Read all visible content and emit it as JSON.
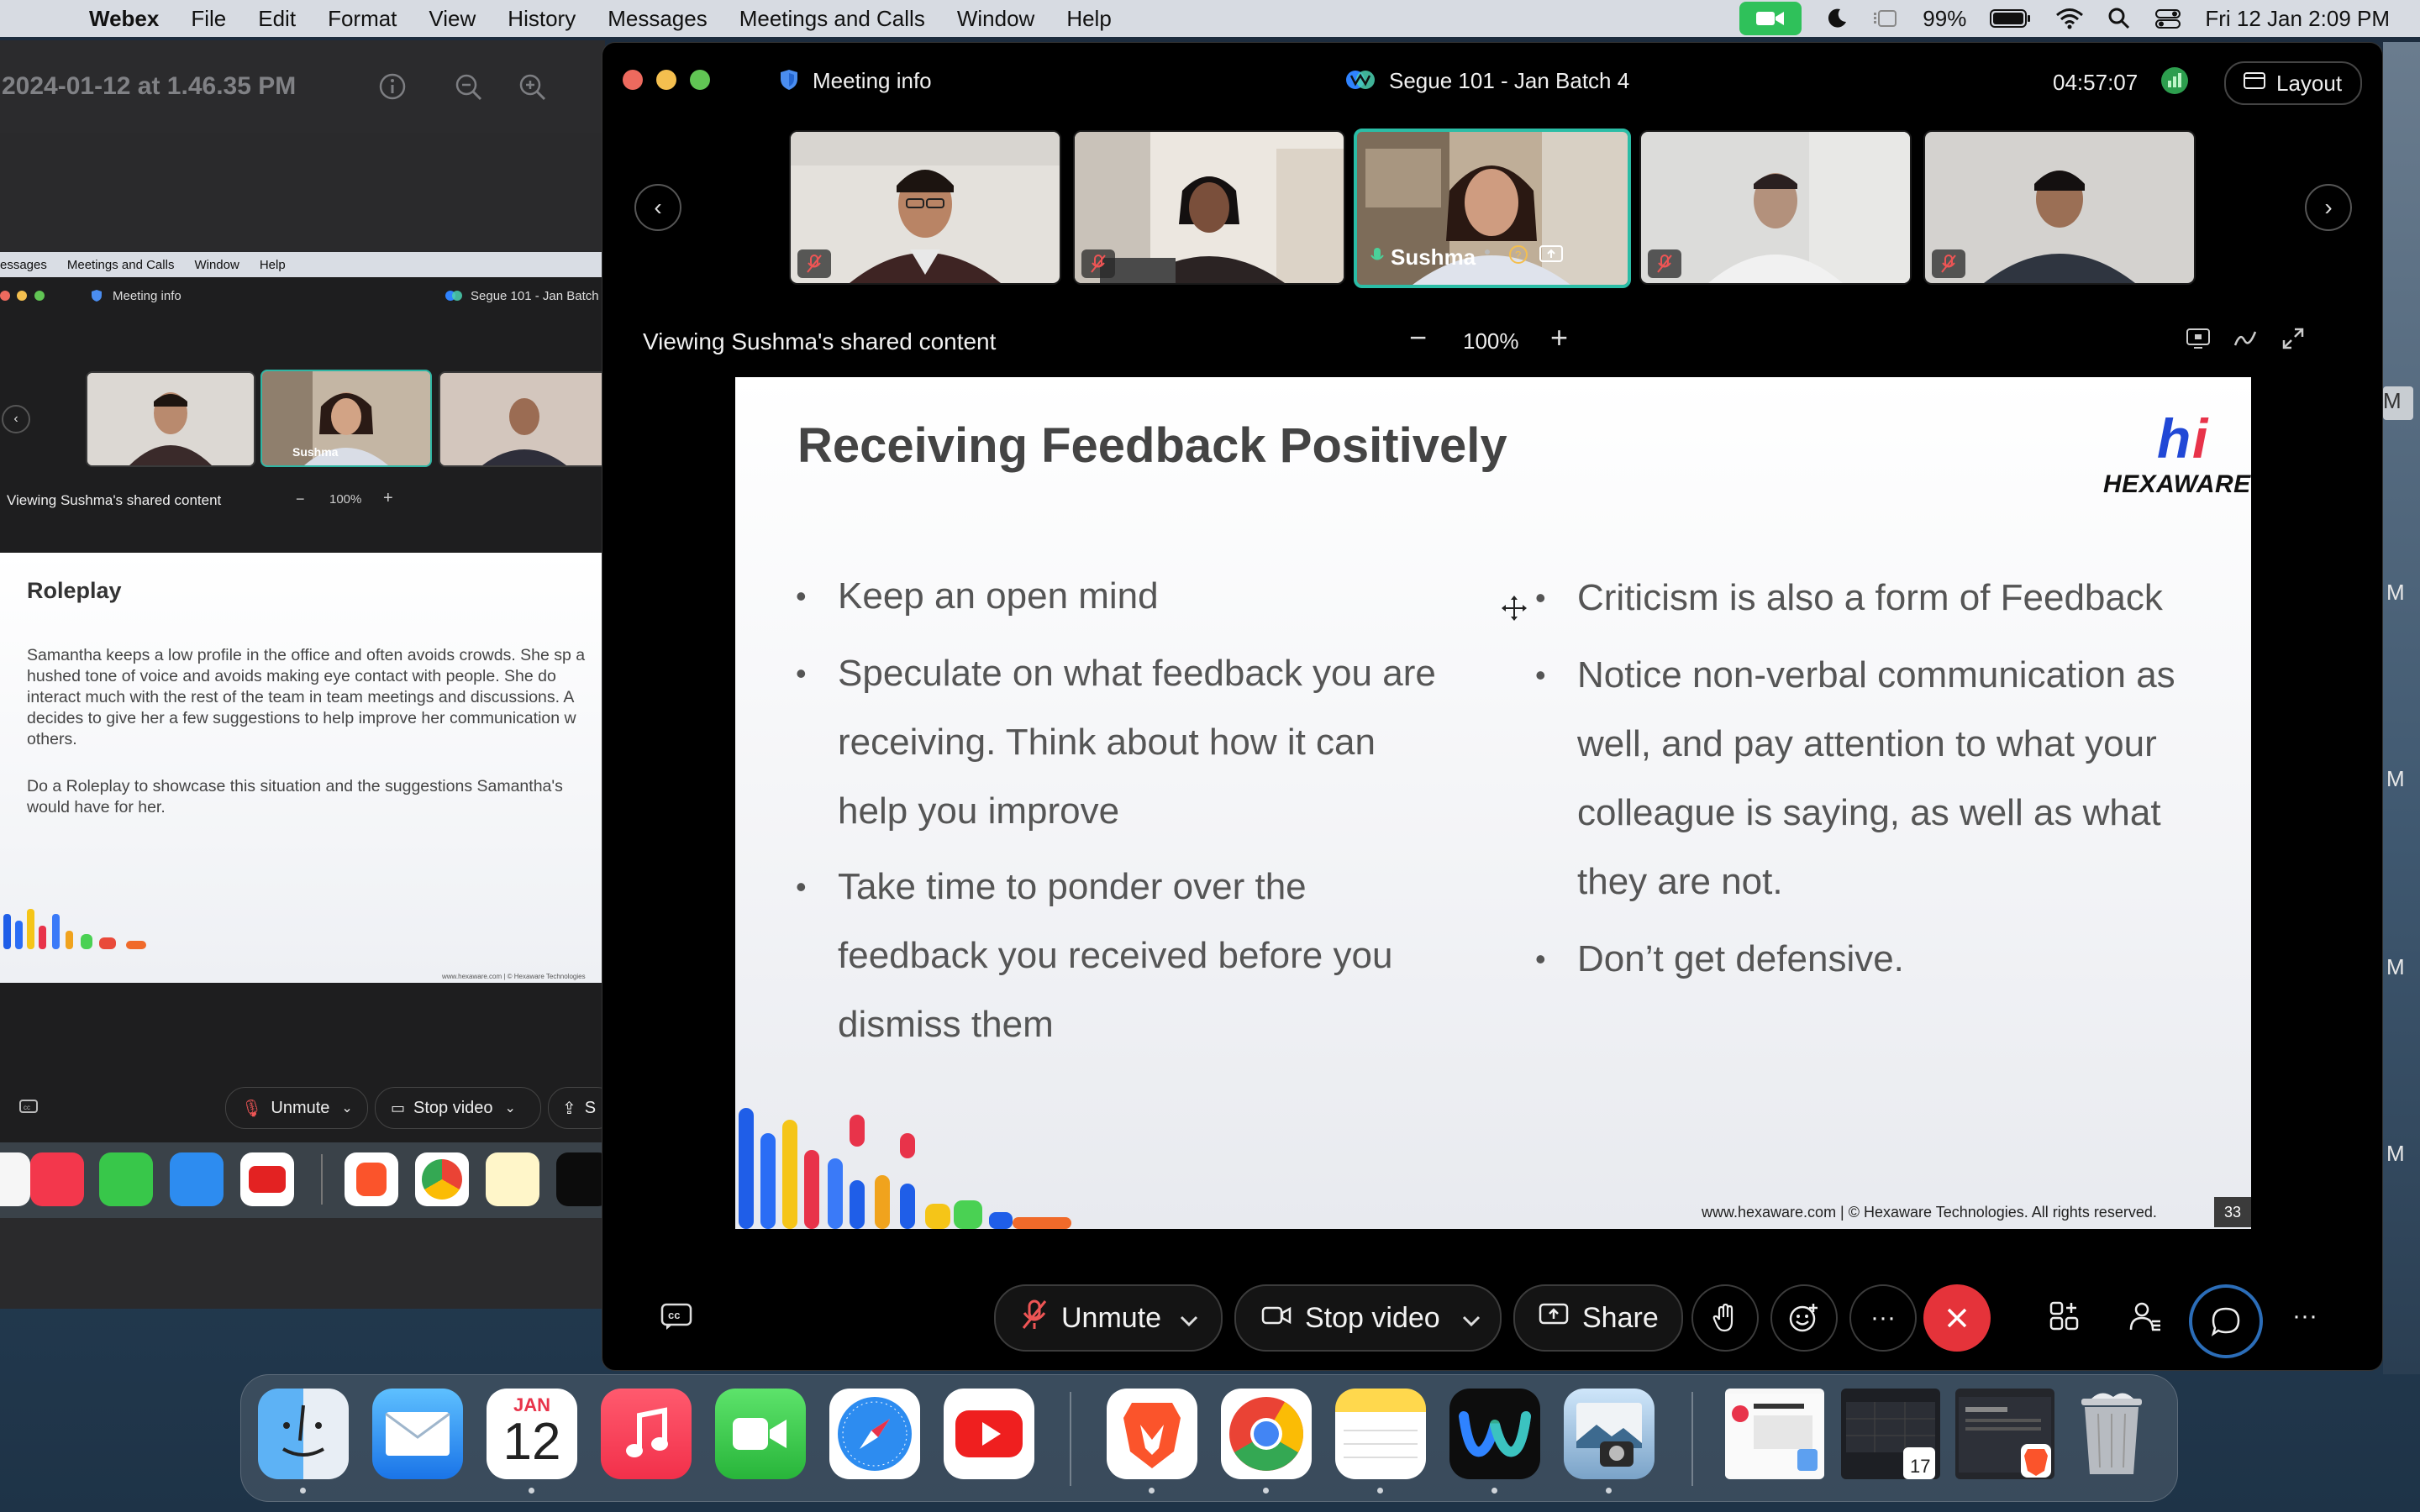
{
  "menubar": {
    "app_name": "Webex",
    "items": [
      "File",
      "Edit",
      "Format",
      "View",
      "History",
      "Messages",
      "Meetings and Calls",
      "Window",
      "Help"
    ],
    "battery": "99%",
    "datetime": "Fri 12 Jan  2:09 PM"
  },
  "bg_window": {
    "filename": "2024-01-12 at 1.46.35 PM",
    "inner_menu": [
      "essages",
      "Meetings and Calls",
      "Window",
      "Help"
    ],
    "inner_meeting_info": "Meeting info",
    "inner_meeting_title": "Segue 101 - Jan Batch",
    "inner_presenter_name": "Sushma",
    "inner_viewing_text": "Viewing Sushma's shared content",
    "inner_zoom": "100%",
    "slide_title": "Roleplay",
    "slide_para1": "Samantha keeps a low profile in the office and often avoids crowds. She sp a hushed tone of voice and avoids making eye contact with people. She do interact much with the rest of the team in team meetings and discussions. A decides to give her a few suggestions to help improve her communication w others.",
    "slide_para2": "Do a Roleplay to showcase this situation and the suggestions Samantha's would have for her.",
    "slide_footer": "www.hexaware.com | © Hexaware Technologies",
    "unmute": "Unmute",
    "stop_video": "Stop video",
    "share_partial": "S"
  },
  "main_window": {
    "meeting_info": "Meeting info",
    "meeting_title": "Segue 101 - Jan Batch 4",
    "timer": "04:57:07",
    "layout_button": "Layout",
    "presenter_name": "Sushma",
    "viewing_text": "Viewing Sushma's shared content",
    "zoom": "100%"
  },
  "slide": {
    "title": "Receiving Feedback Positively",
    "brand_mark": "hi",
    "brand": "HEXAWARE",
    "left_bullets": [
      [
        "Keep an open mind"
      ],
      [
        "Speculate on what feedback you are",
        "receiving. Think about how it can",
        "help you improve"
      ],
      [
        "Take time to ponder over the",
        "feedback you received before you",
        "dismiss them"
      ]
    ],
    "right_bullets": [
      [
        "Criticism is also a form of Feedback"
      ],
      [
        "Notice non-verbal communication as",
        "well, and pay attention to what your",
        "colleague is saying, as well as what",
        "they are not."
      ],
      [
        "Don’t get defensive."
      ]
    ],
    "footer": "www.hexaware.com  | © Hexaware Technologies. All rights reserved.",
    "page_number": "33"
  },
  "toolbar": {
    "unmute": "Unmute",
    "stop_video": "Stop video",
    "share": "Share"
  },
  "dock": {
    "calendar_month": "JAN",
    "calendar_day": "12",
    "badge": "17"
  },
  "side_letters": [
    "M",
    "M",
    "M",
    "M",
    "M"
  ],
  "colors": {
    "accent_teal": "#2bbda6",
    "end_call_red": "#e5333a",
    "facetime_green": "#2fc15a"
  }
}
